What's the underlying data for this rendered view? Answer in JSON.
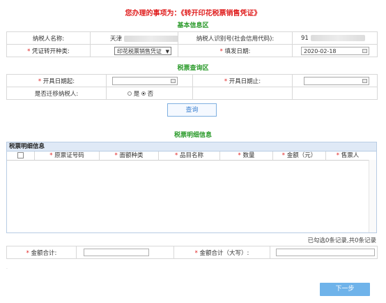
{
  "header": {
    "title": "您办理的事项为：《转开印花税票销售凭证》",
    "basic_section": "基本信息区",
    "query_section": "税票查询区",
    "detail_section": "税票明细信息"
  },
  "basic": {
    "taxpayer_name_label": "纳税人名称:",
    "taxpayer_name_value": "天津",
    "taxpayer_id_label": "纳税人识别号(社会信用代码):",
    "taxpayer_id_value": "91",
    "voucher_type_label": "凭证转开种类:",
    "voucher_type_value": "印花税票销售凭证",
    "fill_date_label": "填发日期:",
    "fill_date_value": "2020-02-18"
  },
  "query": {
    "start_date_label": "开具日期起:",
    "end_date_label": "开具日期止:",
    "migrated_label": "是否迁移纳税人:",
    "yes_label": "是",
    "no_label": "否",
    "query_button": "查询"
  },
  "grid": {
    "title": "税票明细信息",
    "columns": [
      "原票证号码",
      "面额种类",
      "品目名称",
      "数量",
      "金额（元）",
      "售票人"
    ],
    "pager_text": "已勾选0条记录,共0条记录"
  },
  "summary": {
    "total_label": "金额合计:",
    "total_upper_label": "金额合计（大写）:"
  },
  "footer": {
    "next_button": "下一步"
  }
}
